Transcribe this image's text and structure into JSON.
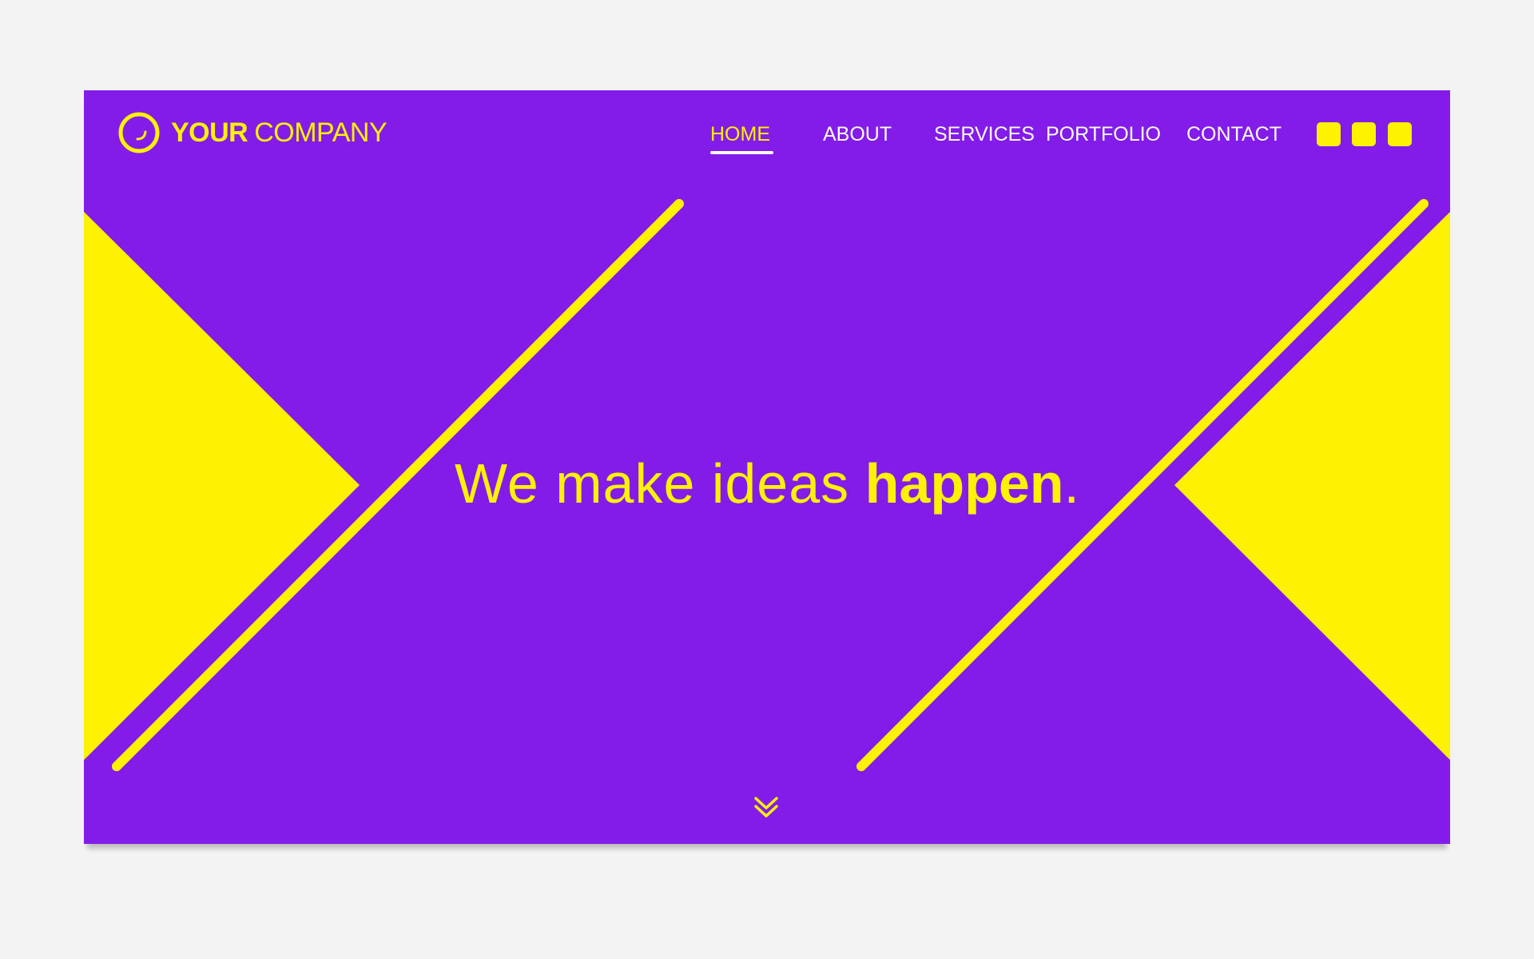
{
  "brand": {
    "logo_icon": "circle-smile-icon",
    "name_bold": "YOUR",
    "name_light": "COMPANY"
  },
  "nav": {
    "items": [
      {
        "label": "HOME",
        "active": true
      },
      {
        "label": "ABOUT",
        "active": false
      },
      {
        "label": "SERVICES",
        "active": false
      },
      {
        "label": "PORTFOLIO",
        "active": false
      },
      {
        "label": "CONTACT",
        "active": false
      }
    ],
    "icon_buttons": [
      "square-icon",
      "square-icon",
      "square-icon"
    ]
  },
  "hero": {
    "headline_light": "We make ideas",
    "headline_bold": "happen",
    "headline_punct": ".",
    "scroll_icon": "double-chevron-down-icon"
  },
  "colors": {
    "background": "#841ce9",
    "accent": "#fff200",
    "nav_text": "#ffffff",
    "page": "#f2f3f2"
  }
}
